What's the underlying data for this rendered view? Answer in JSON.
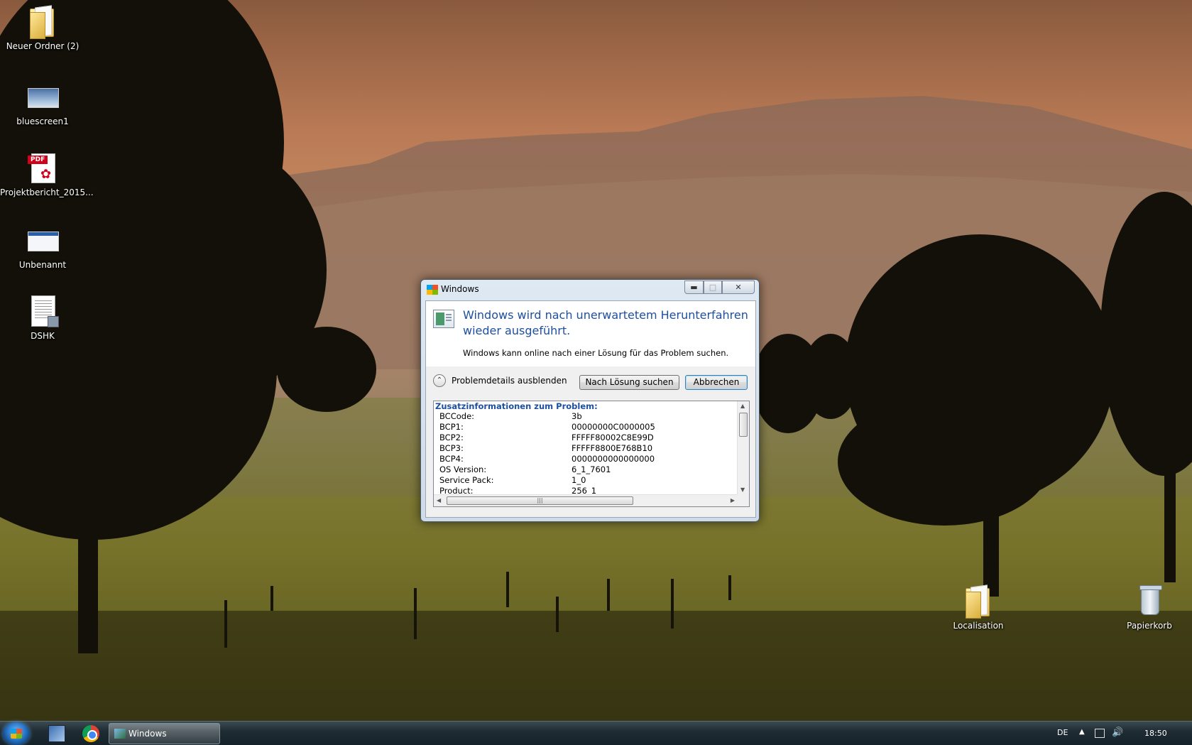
{
  "desktop_icons": [
    {
      "label": "Neuer Ordner (2)",
      "icon": "folder-icon"
    },
    {
      "label": "bluescreen1",
      "icon": "image-file-icon"
    },
    {
      "label": "Projektbericht_2015...",
      "icon": "pdf-file-icon",
      "badge": "PDF"
    },
    {
      "label": "Unbenannt",
      "icon": "image-file-icon"
    },
    {
      "label": "DSHK",
      "icon": "document-file-icon"
    },
    {
      "label": "Localisation",
      "icon": "folder-icon"
    },
    {
      "label": "Papierkorb",
      "icon": "recycle-bin-icon"
    }
  ],
  "dialog": {
    "title": "Windows",
    "main_instruction": "Windows wird nach unerwartetem Herunterfahren wieder ausgeführt.",
    "sub_instruction": "Windows kann online nach einer Lösung für das Problem suchen.",
    "details_toggle": "Problemdetails ausblenden",
    "search_button": "Nach Lösung suchen",
    "cancel_button": "Abbrechen",
    "details_heading": "Zusatzinformationen zum Problem:",
    "details": [
      {
        "key": "BCCode:",
        "value": "3b"
      },
      {
        "key": "BCP1:",
        "value": "00000000C0000005"
      },
      {
        "key": "BCP2:",
        "value": "FFFFF80002C8E99D"
      },
      {
        "key": "BCP3:",
        "value": "FFFFF8800E768B10"
      },
      {
        "key": "BCP4:",
        "value": "0000000000000000"
      },
      {
        "key": "OS Version:",
        "value": "6_1_7601"
      },
      {
        "key": "Service Pack:",
        "value": "1_0"
      },
      {
        "key": "Product:",
        "value": "256_1"
      }
    ]
  },
  "taskbar": {
    "active_task": "Windows",
    "language": "DE",
    "clock": "18:50"
  },
  "colors": {
    "accent_blue": "#1e4fa0",
    "taskbar": "#1f2c33"
  }
}
